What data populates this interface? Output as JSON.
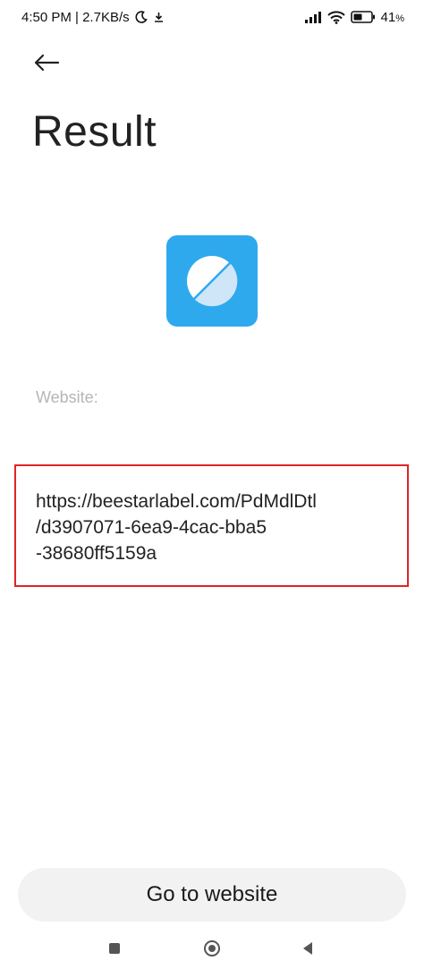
{
  "status_bar": {
    "time_speed": "4:50 PM | 2.7KB/s",
    "battery": "41",
    "battery_percent_sign": "%"
  },
  "page": {
    "title": "Result",
    "field_label": "Website:",
    "url_lines": [
      "https://beestarlabel.com/PdMdlDtl",
      "/d3907071-6ea9-4cac-bba5",
      "-38680ff5159a"
    ],
    "go_button_label": "Go to website"
  },
  "colors": {
    "app_icon": "#2fa9ee",
    "highlight_border": "#e02424",
    "button_bg": "#f2f2f2"
  },
  "icons": {
    "back": "arrow-left-icon",
    "app": "browser-app-icon",
    "moon": "moon-icon",
    "download": "download-icon",
    "signal": "signal-icon",
    "wifi": "wifi-icon",
    "battery": "battery-icon",
    "nav_recents": "square-icon",
    "nav_home": "circle-icon",
    "nav_back": "triangle-back-icon"
  }
}
